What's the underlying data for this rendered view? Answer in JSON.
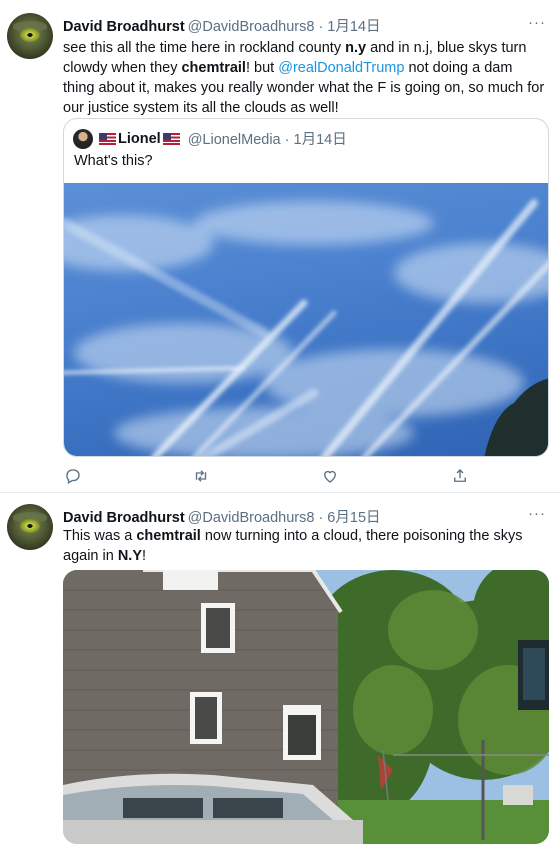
{
  "tweets": [
    {
      "author_name": "David Broadhurst",
      "handle_date": "@DavidBroadhurs8 · 1月14日",
      "text_parts": {
        "p1": "see this all the time here in rockland county ",
        "b1": "n.y",
        "p2": " and in n.j, blue skys turn clowdy when they ",
        "b2": "chemtrail",
        "p3": "! but ",
        "mention": "@realDonaldTrump",
        "p4": " not doing a dam thing about it, makes you really wonder what the F is going on, so much for our justice system its all the clouds as well!"
      },
      "quote": {
        "author_name": "Lionel",
        "handle_date": "@LionelMedia · 1月14日",
        "text": "What's this?",
        "image_icon": "sky-with-chemtrails-photo"
      }
    },
    {
      "author_name": "David Broadhurst",
      "handle_date": "@DavidBroadhurs8 · 6月15日",
      "text_parts": {
        "p1": "This was a ",
        "b1": "chemtrail",
        "p2": " now turning into a cloud, there poisoning the skys again in ",
        "b2": "N.Y",
        "p3": "!"
      },
      "image_icon": "house-trees-sky-photo"
    }
  ],
  "more_label": "···",
  "action_icons": [
    "reply-icon",
    "retweet-icon",
    "like-icon",
    "share-icon"
  ],
  "colors": {
    "link": "#1b95e0",
    "secondary": "#5b7083",
    "border": "#cfd9de"
  }
}
